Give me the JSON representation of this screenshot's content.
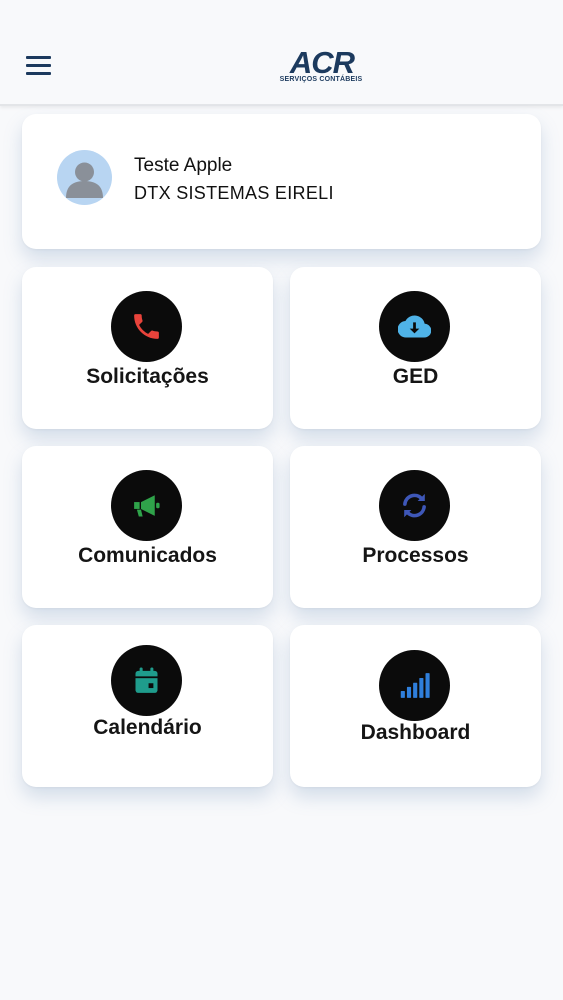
{
  "header": {
    "menu_icon": "hamburger-menu-icon",
    "logo_text": "ACR",
    "logo_subtitle": "SERVIÇOS CONTÁBEIS"
  },
  "profile": {
    "name": "Teste Apple",
    "company": "DTX SISTEMAS EIRELI",
    "avatar_icon": "user-avatar-icon"
  },
  "tiles": [
    {
      "label": "Solicitações",
      "icon": "phone-icon",
      "icon_color": "#e8433b"
    },
    {
      "label": "GED",
      "icon": "cloud-download-icon",
      "icon_color": "#4fb3e8"
    },
    {
      "label": "Comunicados",
      "icon": "megaphone-icon",
      "icon_color": "#2fa34a"
    },
    {
      "label": "Processos",
      "icon": "sync-icon",
      "icon_color": "#3e57b8"
    },
    {
      "label": "Calendário",
      "icon": "calendar-icon",
      "icon_color": "#1f9c8c"
    },
    {
      "label": "Dashboard",
      "icon": "signal-bars-icon",
      "icon_color": "#2f7fdc"
    }
  ],
  "colors": {
    "brand": "#1c3a5e",
    "background": "#f8f9fb",
    "card": "#ffffff"
  }
}
